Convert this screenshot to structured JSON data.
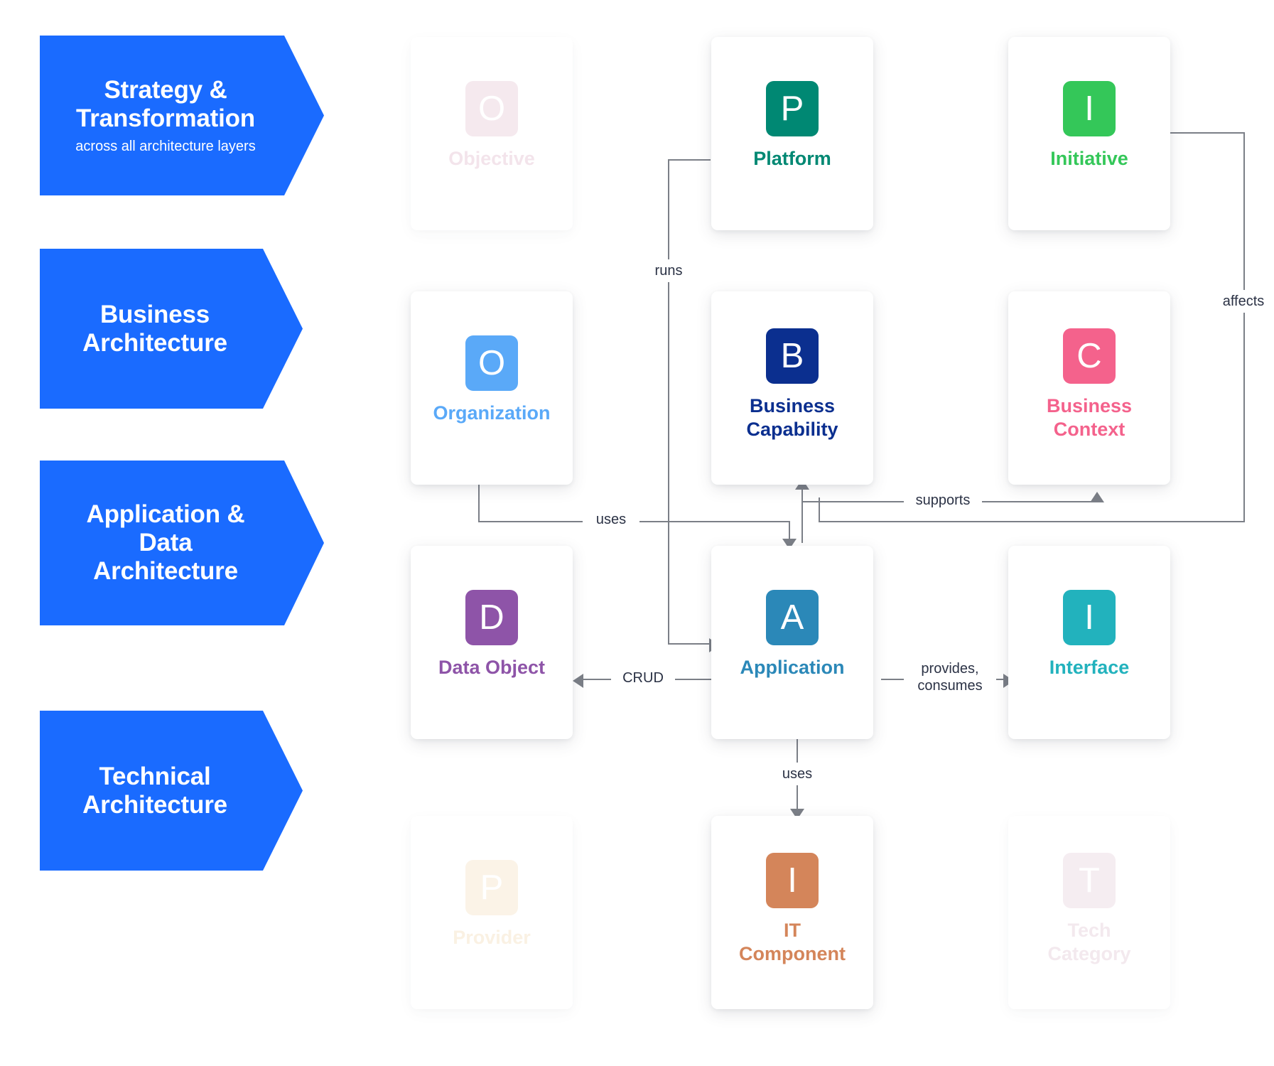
{
  "layers": [
    {
      "id": "strategy",
      "title": "Strategy &\nTransformation",
      "subtitle": "across all architecture layers"
    },
    {
      "id": "business",
      "title": "Business\nArchitecture",
      "subtitle": ""
    },
    {
      "id": "application-data",
      "title": "Application &\nData\nArchitecture",
      "subtitle": ""
    },
    {
      "id": "technical",
      "title": "Technical\nArchitecture",
      "subtitle": ""
    }
  ],
  "cards": [
    {
      "id": "objective",
      "letter": "O",
      "label": "Objective",
      "color": "#e6c6d5",
      "text_color": "#e2b9cd",
      "faded": true
    },
    {
      "id": "platform",
      "letter": "P",
      "label": "Platform",
      "color": "#008873",
      "text_color": "#008873",
      "faded": false
    },
    {
      "id": "initiative",
      "letter": "I",
      "label": "Initiative",
      "color": "#34c759",
      "text_color": "#34c759",
      "faded": false
    },
    {
      "id": "organization",
      "letter": "O",
      "label": "Organization",
      "color": "#5aa9f8",
      "text_color": "#5aa9f8",
      "faded": false
    },
    {
      "id": "business-capability",
      "letter": "B",
      "label": "Business\nCapability",
      "color": "#0b2f8f",
      "text_color": "#0b2f8f",
      "faded": false
    },
    {
      "id": "business-context",
      "letter": "C",
      "label": "Business\nContext",
      "color": "#f4628c",
      "text_color": "#f4628c",
      "faded": false
    },
    {
      "id": "data-object",
      "letter": "D",
      "label": "Data Object",
      "color": "#8e54a8",
      "text_color": "#8e54a8",
      "faded": false
    },
    {
      "id": "application",
      "letter": "A",
      "label": "Application",
      "color": "#2b88b8",
      "text_color": "#2b88b8",
      "faded": false
    },
    {
      "id": "interface",
      "letter": "I",
      "label": "Interface",
      "color": "#22b2bd",
      "text_color": "#22b2bd",
      "faded": false
    },
    {
      "id": "provider",
      "letter": "P",
      "label": "Provider",
      "color": "#f5e2c2",
      "text_color": "#f2dcb6",
      "faded": true
    },
    {
      "id": "it-component",
      "letter": "I",
      "label": "IT\nComponent",
      "color": "#d4855a",
      "text_color": "#d4855a",
      "faded": false
    },
    {
      "id": "tech-category",
      "letter": "T",
      "label": "Tech\nCategory",
      "color": "#e7d0dc",
      "text_color": "#e0c6d4",
      "faded": true
    }
  ],
  "relations": [
    {
      "id": "runs",
      "label": "runs",
      "from": "platform",
      "to": "application"
    },
    {
      "id": "affects",
      "label": "affects",
      "from": "initiative",
      "to": "business-context"
    },
    {
      "id": "uses-org",
      "label": "uses",
      "from": "organization",
      "to": "application"
    },
    {
      "id": "supports",
      "label": "supports",
      "from": "application",
      "to": "business-context"
    },
    {
      "id": "crud",
      "label": "CRUD",
      "from": "application",
      "to": "data-object"
    },
    {
      "id": "provides-consumes",
      "label": "provides,\nconsumes",
      "from": "application",
      "to": "interface"
    },
    {
      "id": "uses-itc",
      "label": "uses",
      "from": "application",
      "to": "it-component"
    }
  ],
  "theme": {
    "banner_color": "#1a6bff",
    "connector_color": "#7b7f87",
    "label_text_color": "#2b3245",
    "background": "#ffffff"
  }
}
